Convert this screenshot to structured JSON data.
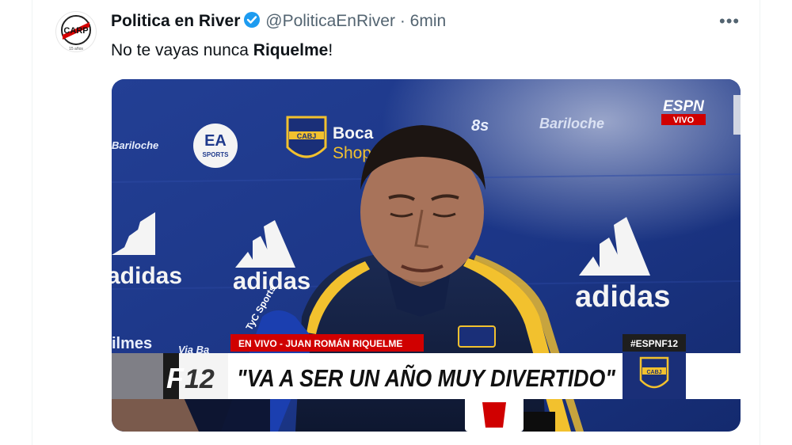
{
  "tweet": {
    "display_name": "Politica en River",
    "handle": "@PoliticaEnRiver",
    "separator": "·",
    "time": "6min",
    "more_glyph": "•••",
    "text_prefix": "No te vayas nunca ",
    "text_bold": "Riquelme",
    "text_suffix": "!"
  },
  "avatar": {
    "letters": "CARP",
    "caption": "15 años"
  },
  "media": {
    "sponsor_bariloche": "Bariloche",
    "sponsor_ea": "EA",
    "sponsor_ea_sub": "SPORTS",
    "crest_text": "CABJ",
    "boca_shop_1": "Boca",
    "boca_shop_2": "Shop",
    "adidas": "adidas",
    "espn": "ESPN",
    "espn_vivo": "VIVO",
    "mic_label": "TyC Sports",
    "lower_third_tag": "EN VIVO - JUAN ROMÁN RIQUELME",
    "f12_f": "F",
    "f12_num": "12",
    "headline": "\"VA A SER UN AÑO MUY DIVERTIDO\"",
    "hashtag": "#ESPNF12",
    "crest_small": "CABJ",
    "partial_left": "ilmes",
    "partial_via": "Via Ba"
  },
  "colors": {
    "blue": "#1d9bf0",
    "backdrop": "#1f3a8c",
    "river_red": "#d50000",
    "gold": "#f2c12e",
    "espn_red": "#d00000"
  }
}
